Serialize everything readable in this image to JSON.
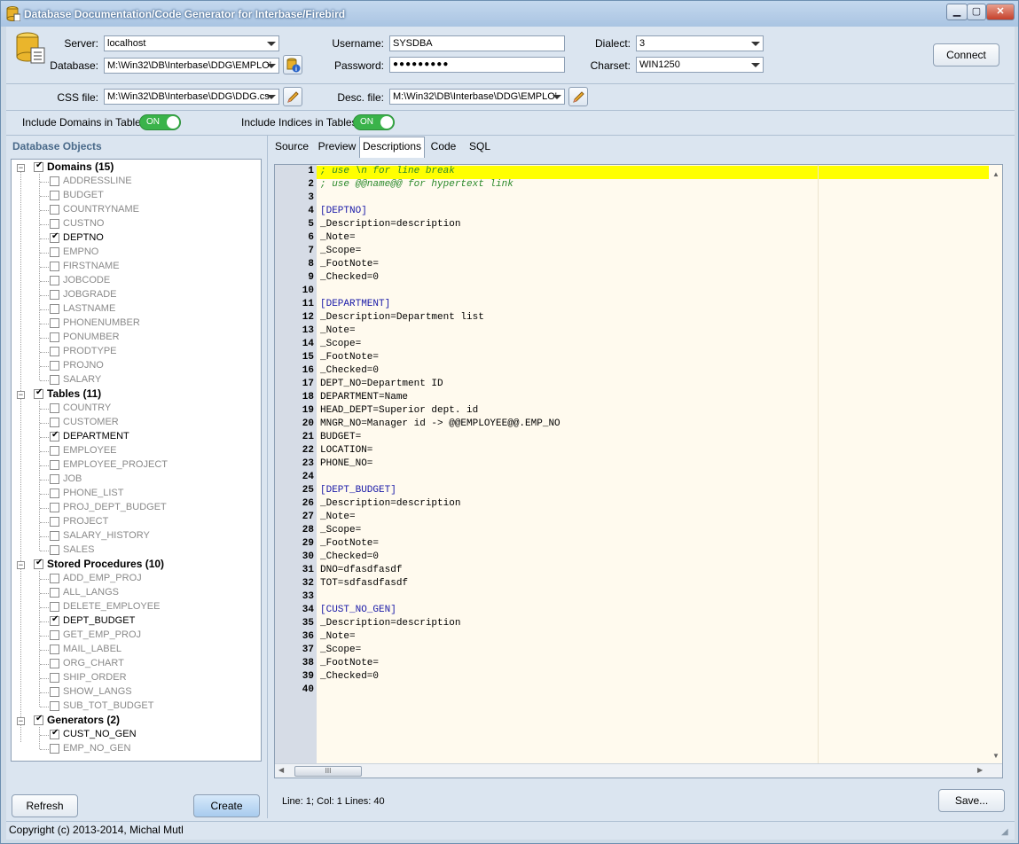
{
  "window": {
    "title": "Database Documentation/Code Generator for Interbase/Firebird"
  },
  "connection": {
    "server_label": "Server:",
    "server_value": "localhost",
    "database_label": "Database:",
    "database_value": "M:\\Win32\\DB\\Interbase\\DDG\\EMPLO'",
    "username_label": "Username:",
    "username_value": "SYSDBA",
    "password_label": "Password:",
    "password_value": "●●●●●●●●●",
    "dialect_label": "Dialect:",
    "dialect_value": "3",
    "charset_label": "Charset:",
    "charset_value": "WIN1250",
    "connect_label": "Connect"
  },
  "files": {
    "css_label": "CSS file:",
    "css_value": "M:\\Win32\\DB\\Interbase\\DDG\\DDG.cs",
    "desc_label": "Desc. file:",
    "desc_value": "M:\\Win32\\DB\\Interbase\\DDG\\EMPLO'"
  },
  "options": {
    "domains_label": "Include Domains in Tables",
    "domains_state": "ON",
    "indices_label": "Include Indices in Tables",
    "indices_state": "ON"
  },
  "tree": {
    "title": "Database Objects",
    "groups": [
      {
        "label": "Domains (15)",
        "items": [
          {
            "label": "ADDRESSLINE",
            "checked": false
          },
          {
            "label": "BUDGET",
            "checked": false
          },
          {
            "label": "COUNTRYNAME",
            "checked": false
          },
          {
            "label": "CUSTNO",
            "checked": false
          },
          {
            "label": "DEPTNO",
            "checked": true
          },
          {
            "label": "EMPNO",
            "checked": false
          },
          {
            "label": "FIRSTNAME",
            "checked": false
          },
          {
            "label": "JOBCODE",
            "checked": false
          },
          {
            "label": "JOBGRADE",
            "checked": false
          },
          {
            "label": "LASTNAME",
            "checked": false
          },
          {
            "label": "PHONENUMBER",
            "checked": false
          },
          {
            "label": "PONUMBER",
            "checked": false
          },
          {
            "label": "PRODTYPE",
            "checked": false
          },
          {
            "label": "PROJNO",
            "checked": false
          },
          {
            "label": "SALARY",
            "checked": false
          }
        ]
      },
      {
        "label": "Tables (11)",
        "items": [
          {
            "label": "COUNTRY",
            "checked": false
          },
          {
            "label": "CUSTOMER",
            "checked": false
          },
          {
            "label": "DEPARTMENT",
            "checked": true
          },
          {
            "label": "EMPLOYEE",
            "checked": false
          },
          {
            "label": "EMPLOYEE_PROJECT",
            "checked": false
          },
          {
            "label": "JOB",
            "checked": false
          },
          {
            "label": "PHONE_LIST",
            "checked": false
          },
          {
            "label": "PROJ_DEPT_BUDGET",
            "checked": false
          },
          {
            "label": "PROJECT",
            "checked": false
          },
          {
            "label": "SALARY_HISTORY",
            "checked": false
          },
          {
            "label": "SALES",
            "checked": false
          }
        ]
      },
      {
        "label": "Stored Procedures (10)",
        "items": [
          {
            "label": "ADD_EMP_PROJ",
            "checked": false
          },
          {
            "label": "ALL_LANGS",
            "checked": false
          },
          {
            "label": "DELETE_EMPLOYEE",
            "checked": false
          },
          {
            "label": "DEPT_BUDGET",
            "checked": true
          },
          {
            "label": "GET_EMP_PROJ",
            "checked": false
          },
          {
            "label": "MAIL_LABEL",
            "checked": false
          },
          {
            "label": "ORG_CHART",
            "checked": false
          },
          {
            "label": "SHIP_ORDER",
            "checked": false
          },
          {
            "label": "SHOW_LANGS",
            "checked": false
          },
          {
            "label": "SUB_TOT_BUDGET",
            "checked": false
          }
        ]
      },
      {
        "label": "Generators (2)",
        "items": [
          {
            "label": "CUST_NO_GEN",
            "checked": true
          },
          {
            "label": "EMP_NO_GEN",
            "checked": false
          }
        ]
      }
    ]
  },
  "buttons": {
    "refresh": "Refresh",
    "create": "Create",
    "save": "Save..."
  },
  "tabs": [
    "Source",
    "Preview",
    "Descriptions",
    "Code",
    "SQL"
  ],
  "active_tab": "Descriptions",
  "editor": {
    "lines": [
      {
        "text": "; use \\n for line break",
        "kind": "comment"
      },
      {
        "text": "; use @@name@@ for hypertext link",
        "kind": "comment"
      },
      {
        "text": "",
        "kind": "plain"
      },
      {
        "text": "[DEPTNO]",
        "kind": "section"
      },
      {
        "text": "_Description=description",
        "kind": "plain"
      },
      {
        "text": "_Note=",
        "kind": "plain"
      },
      {
        "text": "_Scope=",
        "kind": "plain"
      },
      {
        "text": "_FootNote=",
        "kind": "plain"
      },
      {
        "text": "_Checked=0",
        "kind": "plain"
      },
      {
        "text": "",
        "kind": "plain"
      },
      {
        "text": "[DEPARTMENT]",
        "kind": "section"
      },
      {
        "text": "_Description=Department list",
        "kind": "plain"
      },
      {
        "text": "_Note=",
        "kind": "plain"
      },
      {
        "text": "_Scope=",
        "kind": "plain"
      },
      {
        "text": "_FootNote=",
        "kind": "plain"
      },
      {
        "text": "_Checked=0",
        "kind": "plain"
      },
      {
        "text": "DEPT_NO=Department ID",
        "kind": "plain"
      },
      {
        "text": "DEPARTMENT=Name",
        "kind": "plain"
      },
      {
        "text": "HEAD_DEPT=Superior dept. id",
        "kind": "plain"
      },
      {
        "text": "MNGR_NO=Manager id -> @@EMPLOYEE@@.EMP_NO",
        "kind": "plain"
      },
      {
        "text": "BUDGET=",
        "kind": "plain"
      },
      {
        "text": "LOCATION=",
        "kind": "plain"
      },
      {
        "text": "PHONE_NO=",
        "kind": "plain"
      },
      {
        "text": "",
        "kind": "plain"
      },
      {
        "text": "[DEPT_BUDGET]",
        "kind": "section"
      },
      {
        "text": "_Description=description",
        "kind": "plain"
      },
      {
        "text": "_Note=",
        "kind": "plain"
      },
      {
        "text": "_Scope=",
        "kind": "plain"
      },
      {
        "text": "_FootNote=",
        "kind": "plain"
      },
      {
        "text": "_Checked=0",
        "kind": "plain"
      },
      {
        "text": "DNO=dfasdfasdf",
        "kind": "plain"
      },
      {
        "text": "TOT=sdfasdfasdf",
        "kind": "plain"
      },
      {
        "text": "",
        "kind": "plain"
      },
      {
        "text": "[CUST_NO_GEN]",
        "kind": "section"
      },
      {
        "text": "_Description=description",
        "kind": "plain"
      },
      {
        "text": "_Note=",
        "kind": "plain"
      },
      {
        "text": "_Scope=",
        "kind": "plain"
      },
      {
        "text": "_FootNote=",
        "kind": "plain"
      },
      {
        "text": "_Checked=0",
        "kind": "plain"
      },
      {
        "text": "",
        "kind": "plain"
      }
    ]
  },
  "status": {
    "text": "Line: 1;  Col: 1   Lines: 40"
  },
  "footer": {
    "copyright": "Copyright (c) 2013-2014, Michal Mutl"
  },
  "colors": {
    "highlight": "#ffff00",
    "comment": "#2c8a2c",
    "section": "#1a1aa8",
    "toggle_on": "#3ab34a"
  }
}
